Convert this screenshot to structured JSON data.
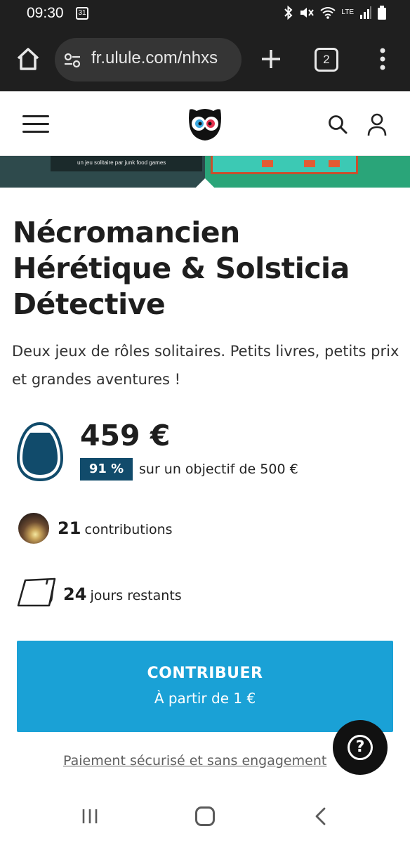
{
  "status_bar": {
    "time": "09:30",
    "calendar_day": "31",
    "network": "LTE",
    "icons": [
      "bluetooth-icon",
      "vibrate-mute-icon",
      "wifi-icon",
      "lte-icon",
      "signal-icon",
      "battery-icon"
    ]
  },
  "browser": {
    "url": "fr.ulule.com/nhxs",
    "tab_count": "2",
    "icons": [
      "home-icon",
      "site-settings-icon",
      "plus-icon",
      "tabs-icon",
      "more-vert-icon"
    ]
  },
  "site_header": {
    "icons": [
      "hamburger-icon",
      "ulule-owl-logo",
      "search-icon",
      "user-icon"
    ]
  },
  "banner": {
    "tagline": "un jeu solitaire par junk food games"
  },
  "project": {
    "title": "Nécromancien Hérétique & Solsticia Détective",
    "subtitle": "Deux jeux de rôles solitaires. Petits livres, petits prix et grandes aventures !"
  },
  "funding": {
    "amount": "459 €",
    "percent": "91 %",
    "percent_value": 0.91,
    "goal_text": "sur un objectif de 500 €",
    "contributions_count": "21",
    "contributions_label": "contributions",
    "days_count": "24",
    "days_label": "jours restants"
  },
  "cta": {
    "label": "CONTRIBUER",
    "sublabel": "À partir de 1 €",
    "secure_text": "Paiement sécurisé et sans engagement"
  },
  "help": {
    "symbol": "?"
  },
  "colors": {
    "primary": "#1aa1d6",
    "badge": "#114b6b",
    "dark_bar": "#1f1f1f"
  }
}
